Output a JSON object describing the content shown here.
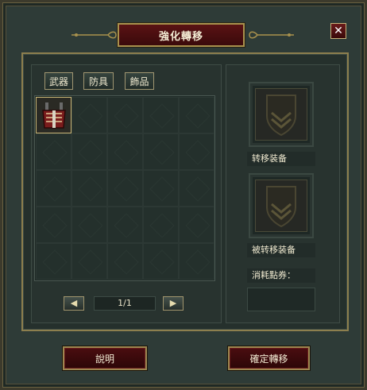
{
  "window": {
    "title": "強化轉移",
    "close_label": "✕"
  },
  "tabs": [
    {
      "label": "武器"
    },
    {
      "label": "防具"
    },
    {
      "label": "飾品"
    }
  ],
  "inventory": {
    "rows": 5,
    "cols": 5,
    "filled_slots": [
      0
    ]
  },
  "pager": {
    "prev_icon": "arrow-left-icon",
    "next_icon": "arrow-right-icon",
    "page_text": "1/1",
    "prev_glyph": "◀",
    "next_glyph": "▶"
  },
  "right": {
    "source_label": "转移装备",
    "target_label": "被转移装备",
    "cost_label": "消耗點券："
  },
  "buttons": {
    "help_label": "說明",
    "confirm_label": "確定轉移"
  },
  "colors": {
    "accent_gold": "#a8914d",
    "title_red": "#5a1214",
    "panel": "#28332f"
  }
}
